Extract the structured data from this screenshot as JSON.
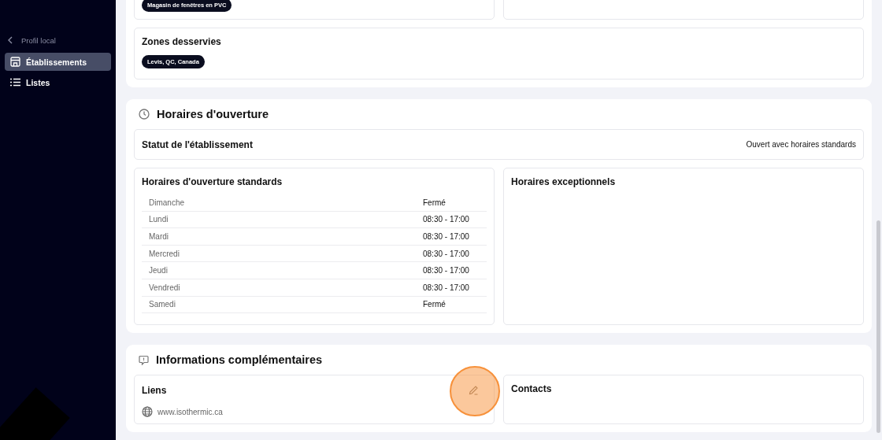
{
  "sidebar": {
    "back_link": "Profil local",
    "items": [
      {
        "label": "Établissements",
        "kind": "store",
        "selected": true
      },
      {
        "label": "Listes",
        "kind": "list",
        "selected": false
      }
    ]
  },
  "activity_section": {
    "top_card": {
      "chips": [
        "Magasin de fenêtres en PVC"
      ]
    },
    "zones_card": {
      "title": "Zones desservies",
      "chips": [
        "Levis, QC, Canada"
      ]
    }
  },
  "hours_section": {
    "title": "Horaires d'ouverture",
    "status": {
      "label": "Statut de l'établissement",
      "value": "Ouvert avec horaires standards"
    },
    "standard": {
      "title": "Horaires d'ouverture standards",
      "rows": [
        {
          "day": "Dimanche",
          "hours": "Fermé"
        },
        {
          "day": "Lundi",
          "hours": "08:30 - 17:00"
        },
        {
          "day": "Mardi",
          "hours": "08:30 - 17:00"
        },
        {
          "day": "Mercredi",
          "hours": "08:30 - 17:00"
        },
        {
          "day": "Jeudi",
          "hours": "08:30 - 17:00"
        },
        {
          "day": "Vendredi",
          "hours": "08:30 - 17:00"
        },
        {
          "day": "Samedi",
          "hours": "Fermé"
        }
      ]
    },
    "exceptional": {
      "title": "Horaires exceptionnels"
    }
  },
  "info_section": {
    "title": "Informations complémentaires",
    "links": {
      "title": "Liens",
      "items": [
        "www.isothermic.ca"
      ]
    },
    "contacts": {
      "title": "Contacts"
    }
  }
}
